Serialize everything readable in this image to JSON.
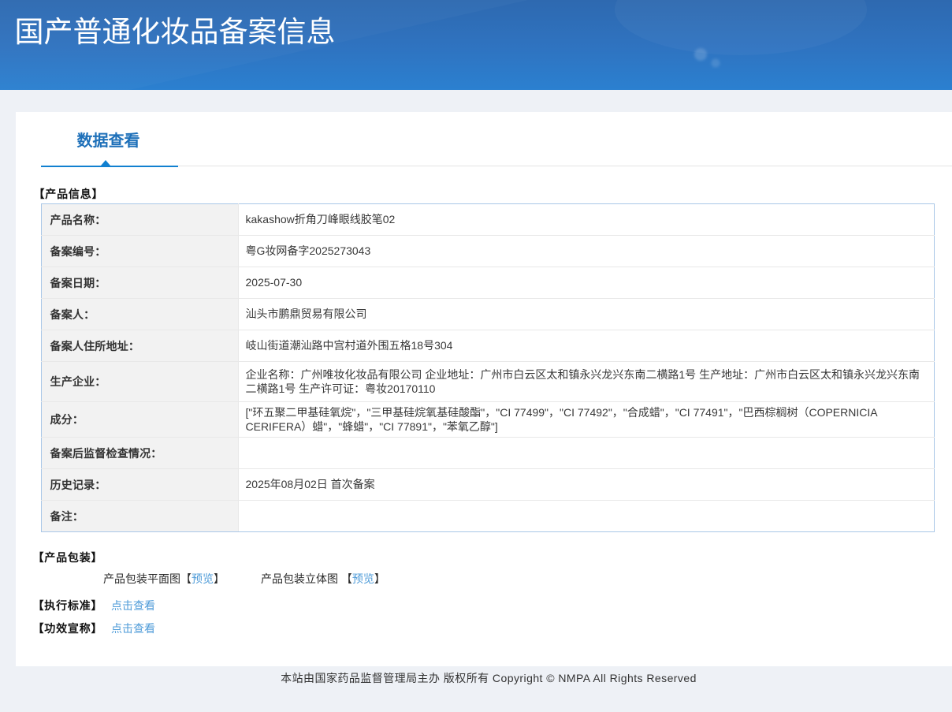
{
  "header": {
    "title": "国产普通化妆品备案信息"
  },
  "tab": {
    "label": "数据查看"
  },
  "sections": {
    "product_info": {
      "heading": "【产品信息】"
    },
    "packaging": {
      "heading": "【产品包装】",
      "items": [
        {
          "label": "产品包装平面图",
          "bracket_open": "【",
          "link": "预览",
          "bracket_close": "】"
        },
        {
          "label": "产品包装立体图 ",
          "bracket_open": "【",
          "link": "预览",
          "bracket_close": "】"
        }
      ]
    },
    "standard": {
      "heading": "【执行标准】",
      "link": "点击查看"
    },
    "efficacy": {
      "heading": "【功效宣称】",
      "link": "点击查看"
    }
  },
  "product_info_table": {
    "rows": [
      {
        "label": "产品名称：",
        "value": "kakashow折角刀峰眼线胶笔02"
      },
      {
        "label": "备案编号：",
        "value": "粤G妆网备字2025273043"
      },
      {
        "label": "备案日期：",
        "value": "2025-07-30"
      },
      {
        "label": "备案人：",
        "value": "汕头市鹏鼎贸易有限公司"
      },
      {
        "label": "备案人住所地址：",
        "value": "岐山街道潮汕路中宫村道外围五格18号304"
      },
      {
        "label": "生产企业：",
        "value": "企业名称：广州唯妆化妆品有限公司 企业地址：广州市白云区太和镇永兴龙兴东南二横路1号 生产地址：广州市白云区太和镇永兴龙兴东南二横路1号 生产许可证：粤妆20170110"
      },
      {
        "label": "成分：",
        "value": "[\"环五聚二甲基硅氧烷\"，\"三甲基硅烷氧基硅酸酯\"，\"CI 77499\"，\"CI 77492\"，\"合成蜡\"，\"CI 77491\"，\"巴西棕榈树（COPERNICIA CERIFERA）蜡\"，\"蜂蜡\"，\"CI 77891\"，\"苯氧乙醇\"]"
      },
      {
        "label": "备案后监督检查情况：",
        "value": ""
      },
      {
        "label": "历史记录：",
        "value": "2025年08月02日 首次备案"
      },
      {
        "label": "备注：",
        "value": ""
      }
    ]
  },
  "footer": {
    "text": "本站由国家药品监督管理局主办 版权所有 Copyright © NMPA All Rights Reserved"
  },
  "colors": {
    "banner_gradient_start": "#2b63a9",
    "banner_gradient_end": "#3380d3",
    "tab_text": "#1e70b9",
    "tab_underline": "#1180d0",
    "link": "#4e9bd8",
    "label_bg": "#f2f2f2",
    "table_outer_border": "#a9c7e7",
    "table_inner_border": "#e8e8e8",
    "page_bg": "#eef1f6"
  }
}
